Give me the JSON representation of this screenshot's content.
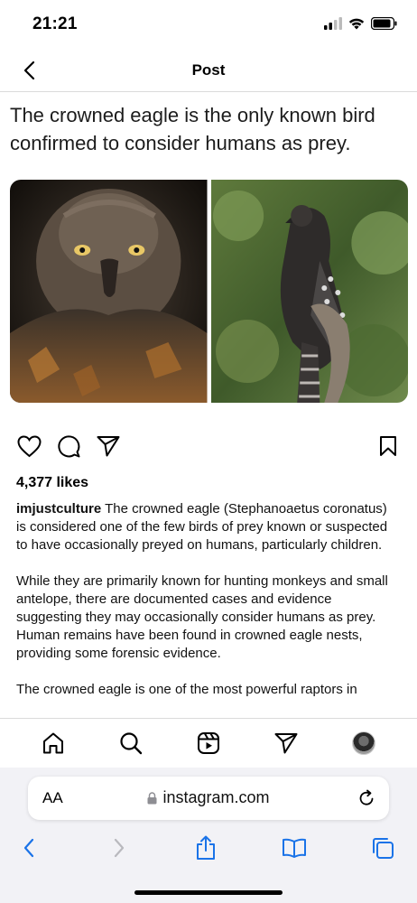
{
  "status_bar": {
    "time": "21:21"
  },
  "header": {
    "title": "Post"
  },
  "post": {
    "heading": "The crowned eagle is the only known bird confirmed to consider humans as prey.",
    "likes": "4,377 likes",
    "username": "imjustculture",
    "caption_p1": "The crowned eagle (Stephanoaetus coronatus) is considered one of the few birds of prey known or suspected to have occasionally preyed on humans, particularly children.",
    "caption_p2": "While they are primarily known for hunting monkeys and small antelope, there are documented cases and evidence suggesting they may occasionally consider humans as prey. Human remains have been found in crowned eagle nests, providing some forensic evidence.",
    "caption_p3": "The crowned eagle is one of the most powerful raptors in"
  },
  "browser": {
    "text_size_label": "AA",
    "url": "instagram.com"
  },
  "icons": {
    "back": "chevron-left-icon",
    "like": "heart-icon",
    "comment": "comment-icon",
    "share": "send-icon",
    "save": "bookmark-icon",
    "home": "home-icon",
    "search": "search-icon",
    "reels": "reels-icon",
    "messages": "send-icon",
    "lock": "lock-icon",
    "reload": "reload-icon",
    "browser_back": "chevron-left-icon",
    "browser_forward": "chevron-right-icon",
    "browser_share": "share-icon",
    "bookmarks": "book-icon",
    "tabs": "tabs-icon"
  },
  "colors": {
    "safari_blue": "#1a73e8",
    "divider": "#dbdbdb"
  }
}
